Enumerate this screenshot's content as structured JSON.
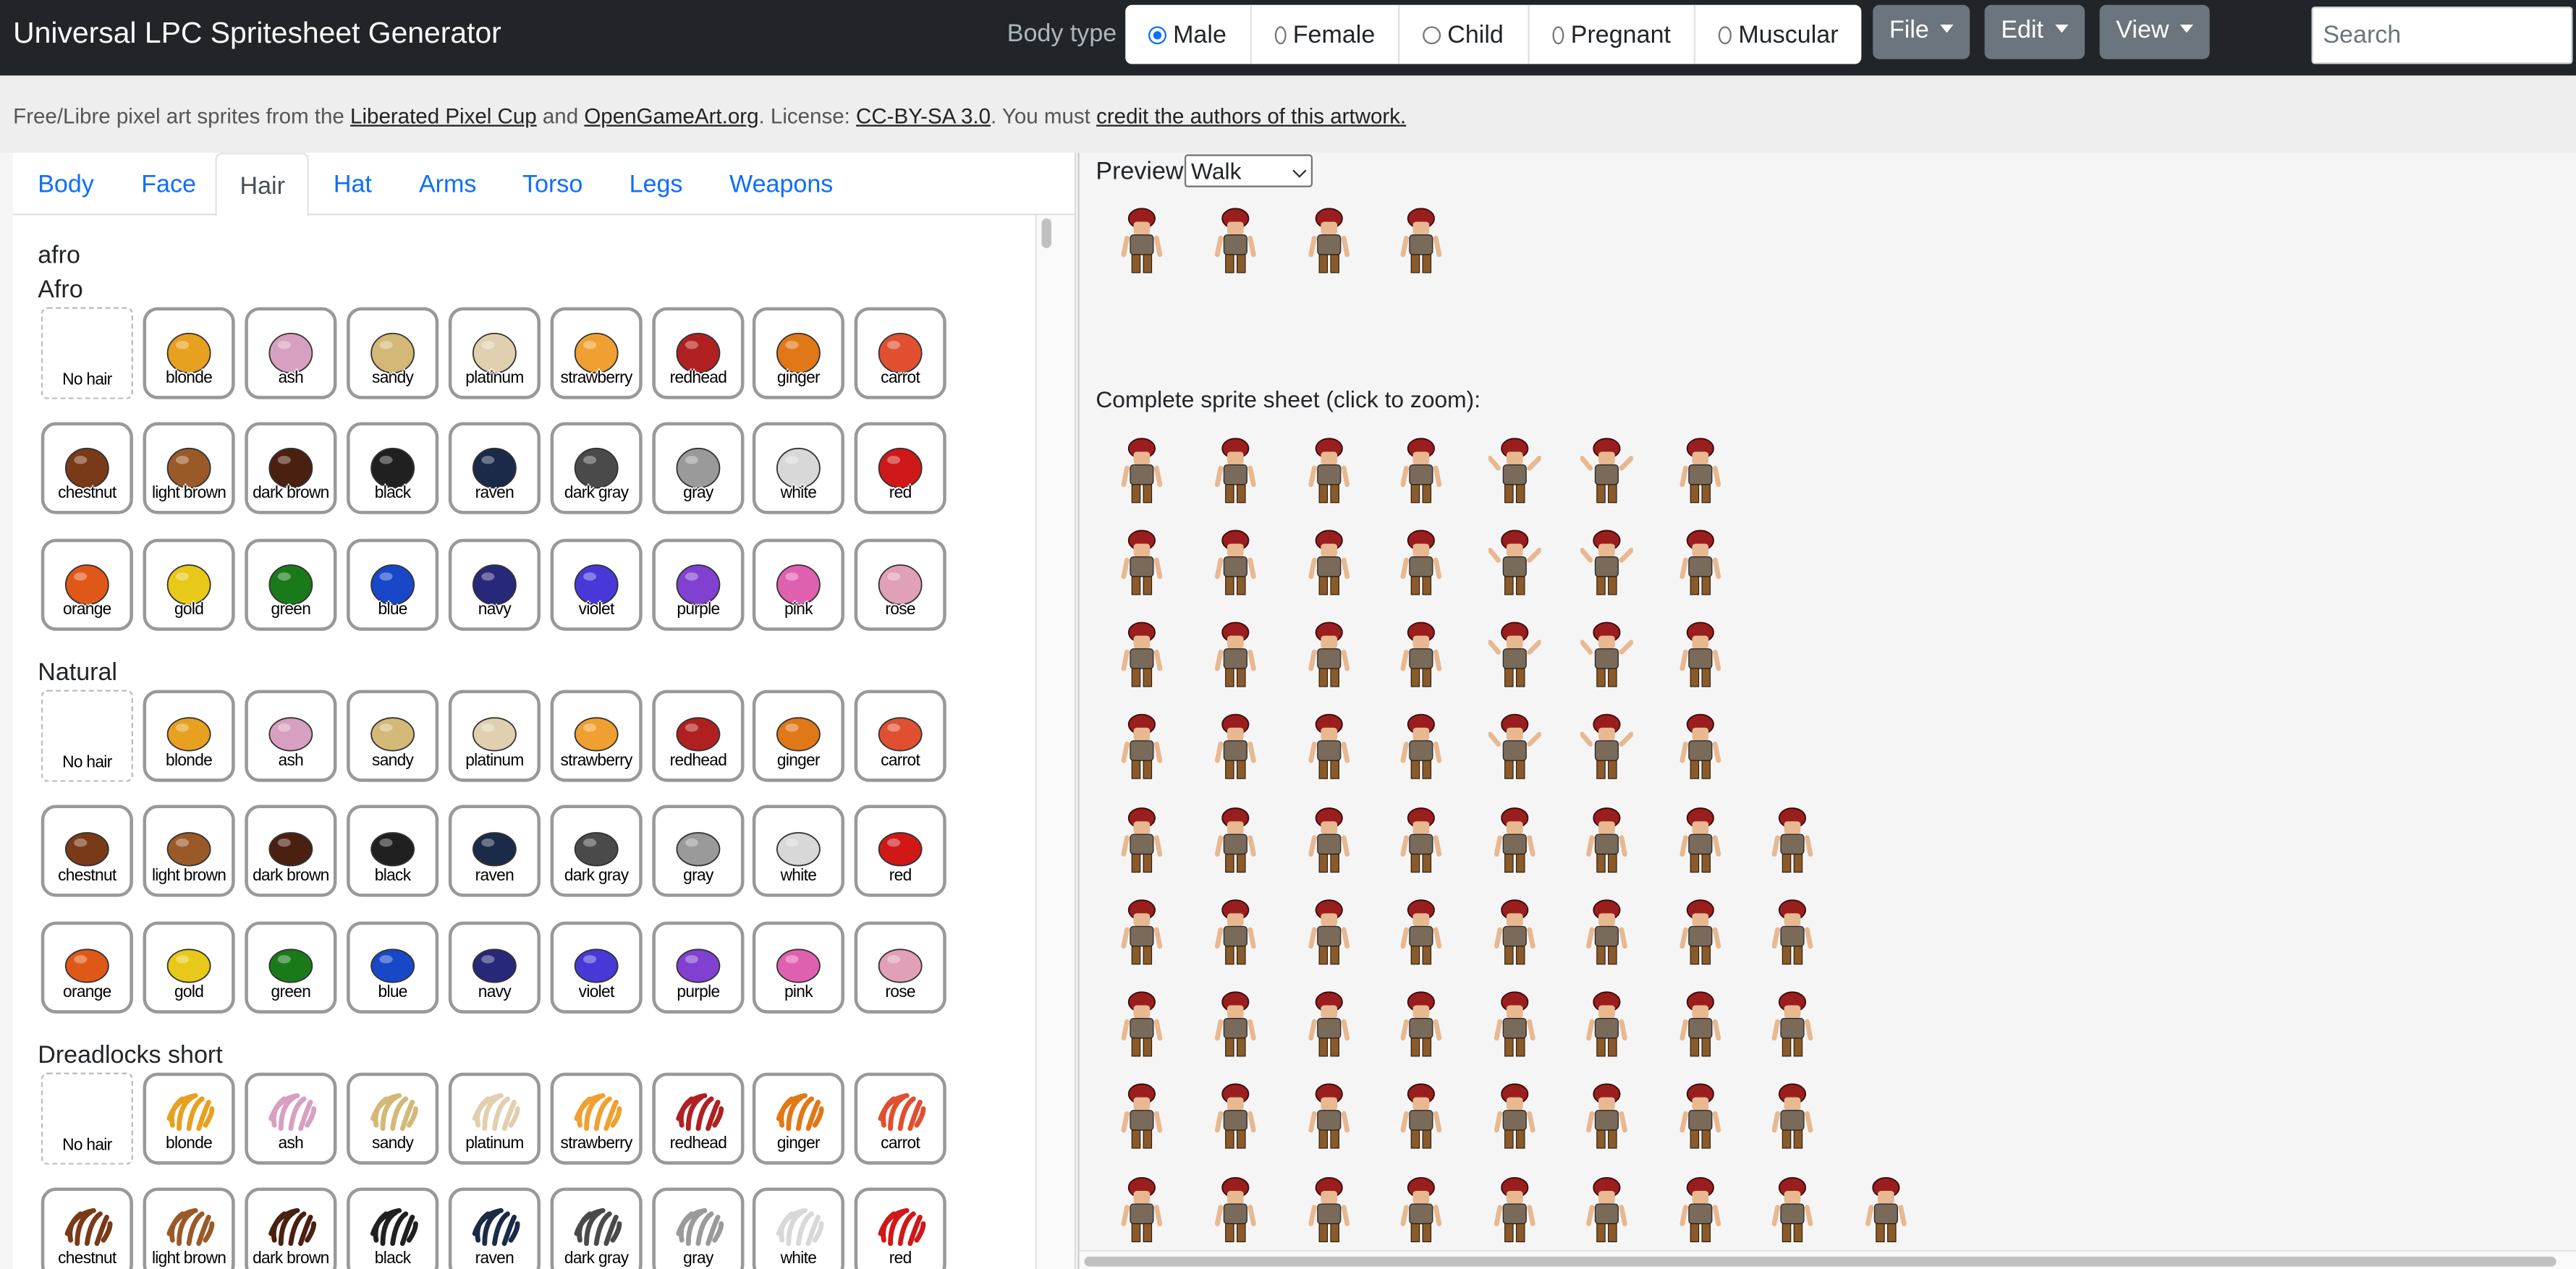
{
  "app": {
    "title": "Universal LPC Spritesheet Generator"
  },
  "body_type": {
    "label": "Body type",
    "options": [
      "Male",
      "Female",
      "Child",
      "Pregnant",
      "Muscular"
    ],
    "selected": "Male"
  },
  "menus": {
    "file": "File",
    "edit": "Edit",
    "view": "View"
  },
  "search": {
    "placeholder": "Search"
  },
  "notice": {
    "prefix": "Free/Libre pixel art sprites from the ",
    "lpc_link": "Liberated Pixel Cup",
    "and": " and ",
    "oga_link": "OpenGameArt.org",
    "license_text": ". License: ",
    "license_link": "CC-BY-SA 3.0",
    "must": ". You must ",
    "credit_link": "credit the authors of this artwork."
  },
  "tabs": [
    "Body",
    "Face",
    "Hair",
    "Hat",
    "Arms",
    "Torso",
    "Legs",
    "Weapons"
  ],
  "active_tab": "Hair",
  "hair": {
    "group_name": "afro",
    "categories": [
      "Afro",
      "Natural",
      "Dreadlocks short"
    ],
    "colors": [
      "No hair",
      "blonde",
      "ash",
      "sandy",
      "platinum",
      "strawberry",
      "redhead",
      "ginger",
      "carrot",
      "chestnut",
      "light brown",
      "dark brown",
      "black",
      "raven",
      "dark gray",
      "gray",
      "white",
      "red",
      "orange",
      "gold",
      "green",
      "blue",
      "navy",
      "violet",
      "purple",
      "pink",
      "rose"
    ],
    "swatches": [
      "",
      "#e8a020",
      "#d8a0c0",
      "#d4b878",
      "#e0d0b0",
      "#f0a030",
      "#b02020",
      "#e07818",
      "#e05030",
      "#7a3a18",
      "#9a5a28",
      "#4a2010",
      "#202020",
      "#1a2a48",
      "#4a4a4a",
      "#9a9a9a",
      "#d8d8d8",
      "#d01818",
      "#e05818",
      "#e8c818",
      "#1a7a1a",
      "#1848c8",
      "#28287a",
      "#4838d8",
      "#8040d0",
      "#e060b0",
      "#e0a0b8"
    ]
  },
  "preview": {
    "label": "Preview",
    "animation": "Walk",
    "sheet_label": "Complete sprite sheet (click to zoom):"
  },
  "sprite_colors": {
    "hair": "#9a1e1e",
    "skin": "#e8b890",
    "shirt": "#7a6a5a",
    "pants": "#8a5a2a"
  }
}
